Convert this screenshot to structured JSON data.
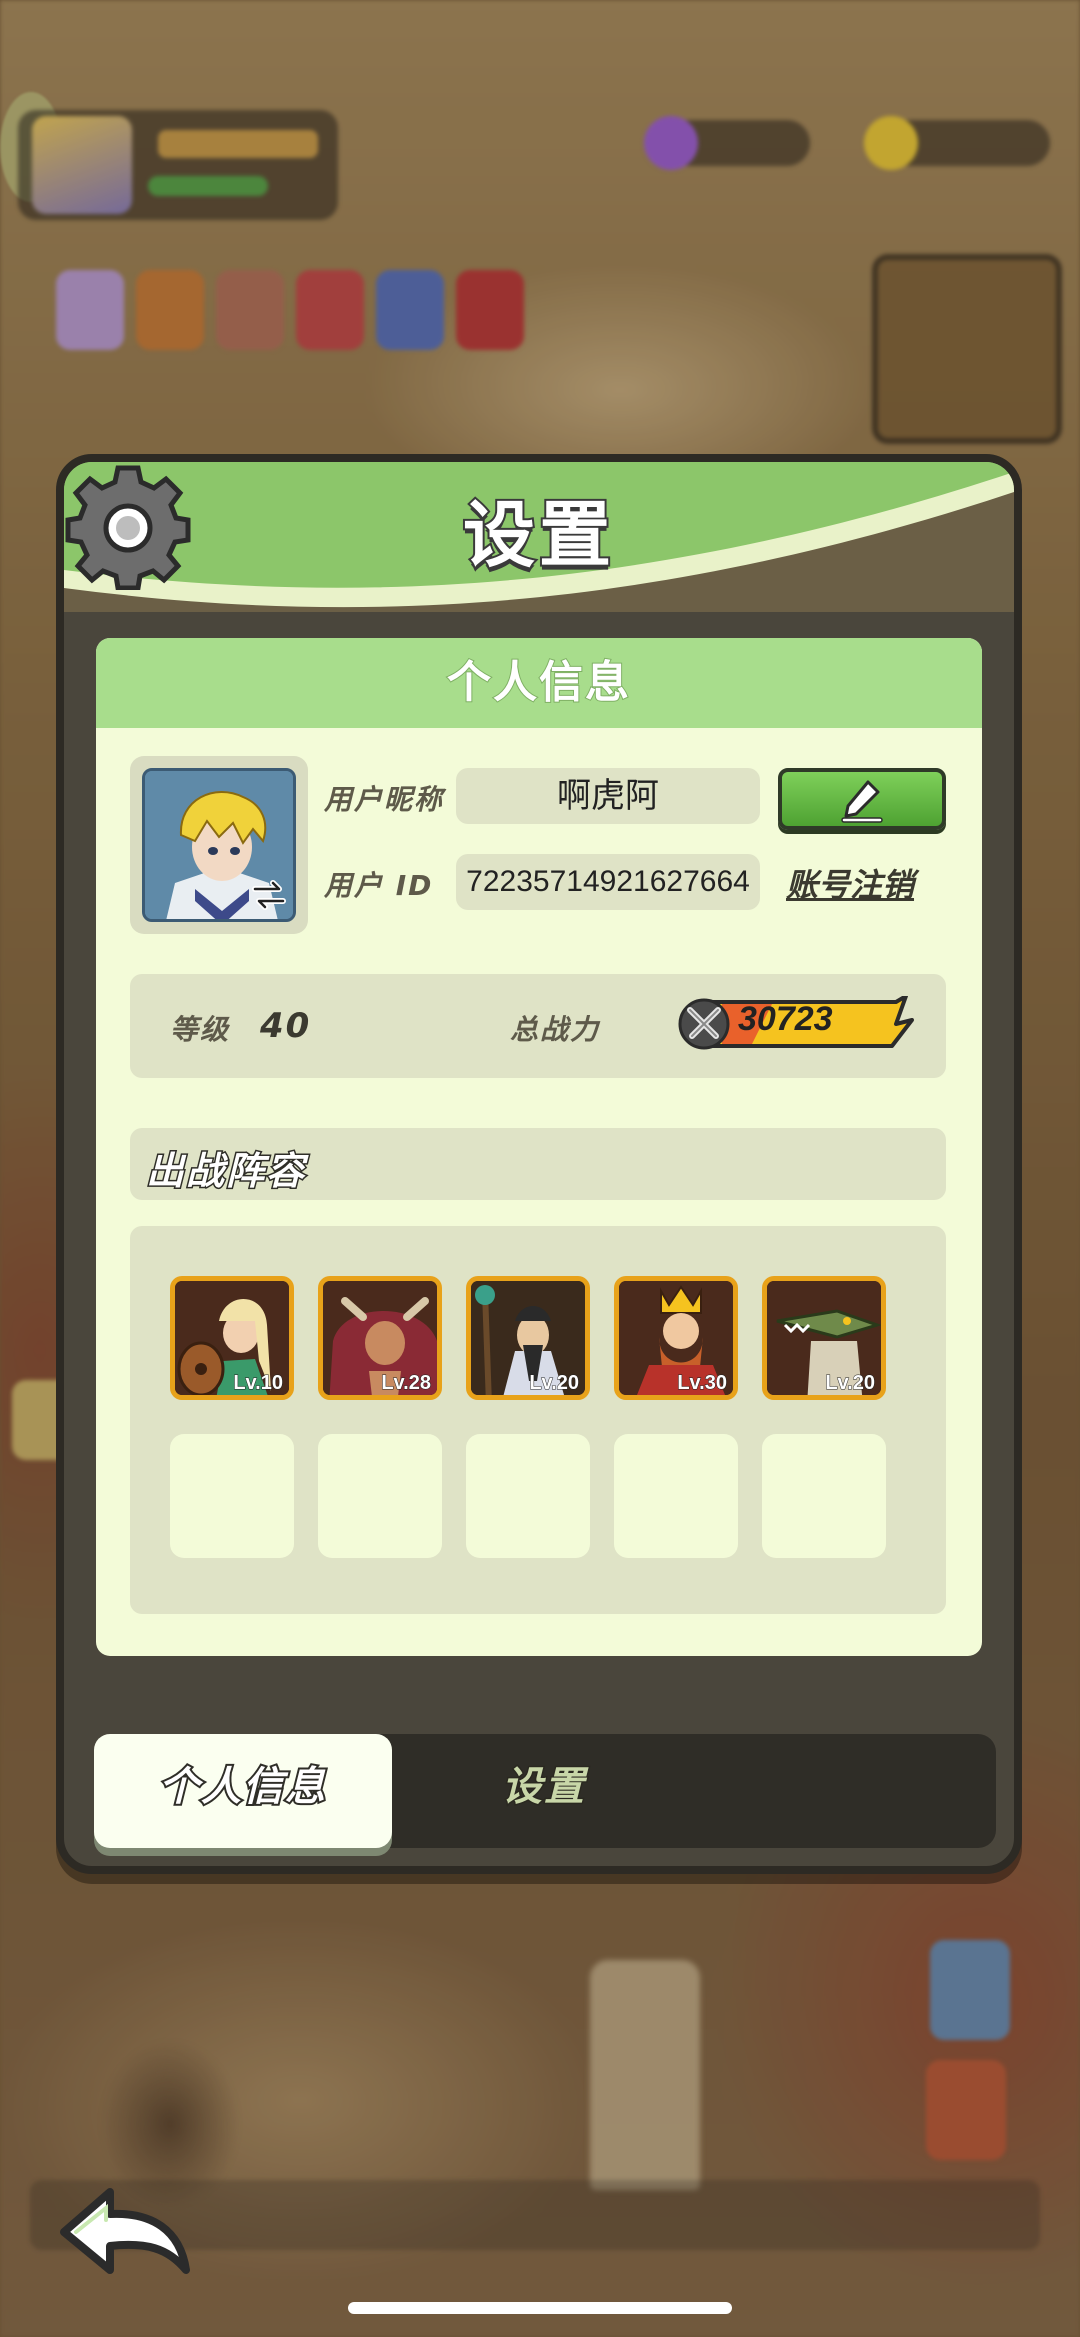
{
  "panel": {
    "title": "设置"
  },
  "profile": {
    "section_title": "个人信息",
    "nickname_label": "用户昵称",
    "nickname_value": "啊虎阿",
    "id_label": "用户 ID",
    "id_value": "72235714921627664",
    "cancel_account": "账号注销"
  },
  "stats": {
    "level_label": "等级",
    "level_value": "40",
    "power_label": "总战力",
    "power_value": "30723"
  },
  "lineup": {
    "title": "出战阵容",
    "heroes": [
      {
        "level": "Lv.10",
        "color": "#c9a24a"
      },
      {
        "level": "Lv.28",
        "color": "#8a2a35"
      },
      {
        "level": "Lv.20",
        "color": "#2b3a4a"
      },
      {
        "level": "Lv.30",
        "color": "#b8322a"
      },
      {
        "level": "Lv.20",
        "color": "#6f8a4a"
      }
    ],
    "empty_slots": 5
  },
  "tabs": [
    {
      "label": "个人信息",
      "active": true
    },
    {
      "label": "设置",
      "active": false
    }
  ],
  "colors": {
    "header_green": "#8cc66a",
    "card_bg": "#f3fbd8",
    "power_gold": "#f5c31f",
    "accent_button": "#5fb63f"
  },
  "icons": {
    "header": "gear-icon",
    "edit": "pencil-icon",
    "avatar_swap": "swap-arrows-icon",
    "power": "crossed-swords-icon",
    "back": "back-arrow-icon"
  }
}
